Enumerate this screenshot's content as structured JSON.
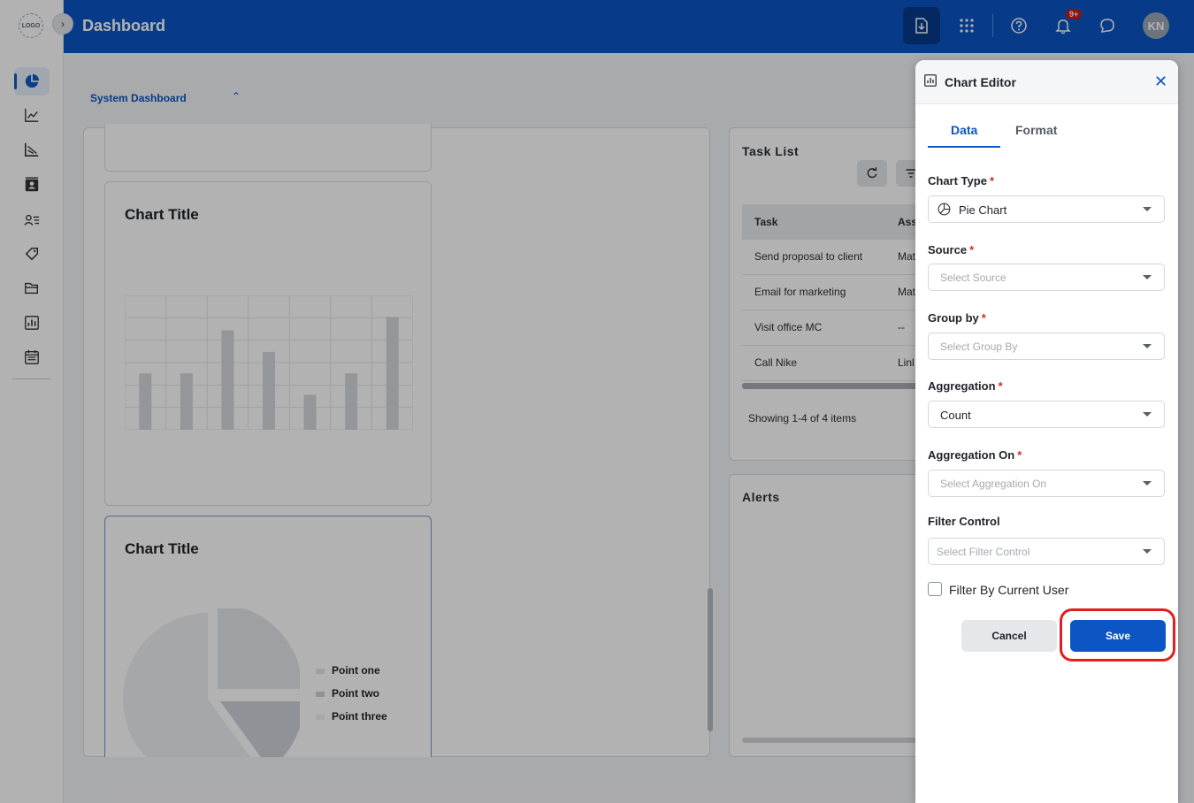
{
  "sidebar": {
    "logo_text": "LOGO",
    "expand_glyph": "›",
    "items": [
      {
        "icon": "pie-chart-icon",
        "active": true
      },
      {
        "icon": "line-chart-icon"
      },
      {
        "icon": "chart-axis-icon"
      },
      {
        "icon": "contacts-icon"
      },
      {
        "icon": "user-list-icon"
      },
      {
        "icon": "tag-icon"
      },
      {
        "icon": "folder-icon"
      },
      {
        "icon": "bar-report-icon"
      },
      {
        "icon": "calendar-icon"
      }
    ]
  },
  "header": {
    "title": "Dashboard",
    "notification_badge": "9+",
    "avatar_initials": "KN",
    "icons": [
      "download-icon",
      "apps-grid-icon",
      "help-icon",
      "bell-icon",
      "chat-icon"
    ]
  },
  "dashboard": {
    "selector_label": "System Dashboard",
    "selector_glyph": "⌃"
  },
  "widgets": {
    "bar_chart": {
      "title": "Chart Title",
      "chart_data": {
        "type": "bar",
        "values": [
          42,
          42,
          74,
          58,
          26,
          42,
          84
        ],
        "ylim": [
          0,
          100
        ]
      }
    },
    "pie_chart": {
      "title": "Chart Title",
      "chart_data": {
        "type": "pie",
        "categories": [
          "Point one",
          "Point two",
          "Point three"
        ],
        "values": [
          25,
          15,
          60
        ]
      },
      "legend": [
        "Point one",
        "Point two",
        "Point three"
      ]
    }
  },
  "task_list": {
    "title": "Task List",
    "columns": [
      "Task",
      "Ass"
    ],
    "rows": [
      {
        "task": "Send proposal to client",
        "assignee": "Mat"
      },
      {
        "task": "Email for marketing",
        "assignee": "Mat"
      },
      {
        "task": "Visit office MC",
        "assignee": "--"
      },
      {
        "task": "Call Nike",
        "assignee": "Linl"
      }
    ],
    "showing": "Showing 1-4 of 4 items"
  },
  "alerts": {
    "title": "Alerts"
  },
  "chart_editor": {
    "title": "Chart Editor",
    "close_glyph": "✕",
    "tabs": {
      "data": "Data",
      "format": "Format"
    },
    "fields": {
      "chart_type": {
        "label": "Chart Type",
        "value": "Pie Chart"
      },
      "source": {
        "label": "Source",
        "placeholder": "Select Source"
      },
      "group_by": {
        "label": "Group by",
        "placeholder": "Select Group By"
      },
      "aggregation": {
        "label": "Aggregation",
        "value": "Count"
      },
      "aggregation_on": {
        "label": "Aggregation On",
        "placeholder": "Select Aggregation On"
      },
      "filter_control": {
        "label": "Filter Control",
        "placeholder": "Select Filter Control"
      }
    },
    "required_mark": "*",
    "filter_current_user": "Filter By Current User",
    "cancel_label": "Cancel",
    "save_label": "Save"
  },
  "colors": {
    "brand": "#0b55c5",
    "highlight": "#e02020"
  }
}
